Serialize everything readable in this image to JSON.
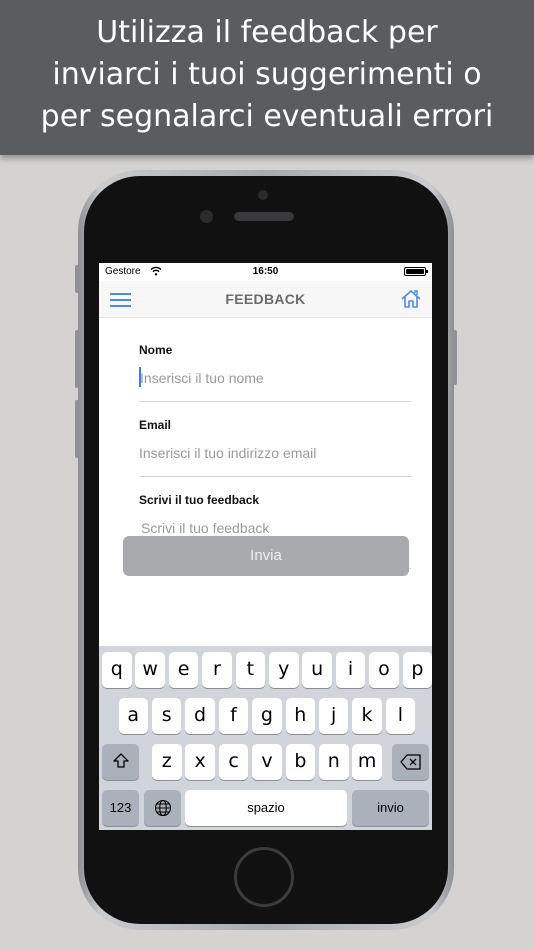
{
  "banner": {
    "line1": "Utilizza il feedback per",
    "line2": "inviarci i tuoi suggerimenti o",
    "line3": "per segnalarci eventuali errori"
  },
  "status_bar": {
    "carrier": "Gestore",
    "time": "16:50"
  },
  "nav": {
    "title": "FEEDBACK"
  },
  "form": {
    "name_label": "Nome",
    "name_placeholder": "Inserisci il tuo nome",
    "email_label": "Email",
    "email_placeholder": "Inserisci il tuo indirizzo email",
    "feedback_label": "Scrivi il tuo feedback",
    "feedback_placeholder": "Scrivi il tuo feedback",
    "send_label": "Invia"
  },
  "keyboard": {
    "row1": [
      "q",
      "w",
      "e",
      "r",
      "t",
      "y",
      "u",
      "i",
      "o",
      "p"
    ],
    "row2": [
      "a",
      "s",
      "d",
      "f",
      "g",
      "h",
      "j",
      "k",
      "l"
    ],
    "row3": [
      "z",
      "x",
      "c",
      "v",
      "b",
      "n",
      "m"
    ],
    "numbers_label": "123",
    "space_label": "spazio",
    "return_label": "invio"
  },
  "colors": {
    "accent": "#4a8ee8",
    "banner_bg": "#5a5c5e",
    "background": "#d4d3d1",
    "send_button": "#a9aaad"
  }
}
